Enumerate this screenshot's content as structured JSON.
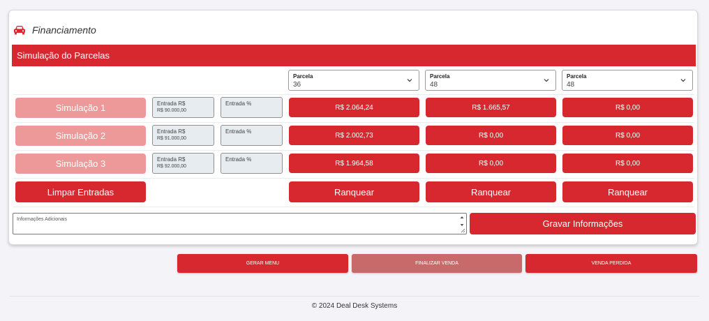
{
  "card": {
    "title": "Financiamento",
    "section_title": "Simulação do Parcelas",
    "selects": [
      {
        "label": "Parcela",
        "value": "36"
      },
      {
        "label": "Parcela",
        "value": "48"
      },
      {
        "label": "Parcela",
        "value": "48"
      }
    ],
    "simulations": [
      {
        "label": "Simulação 1",
        "entry_rs_label": "Entrada R$",
        "entry_rs_value": "R$ 90.000,00",
        "entry_pct_label": "Entrada %",
        "values": [
          "R$ 2.064,24",
          "R$ 1.665,57",
          "R$ 0,00"
        ]
      },
      {
        "label": "Simulação 2",
        "entry_rs_label": "Entrada R$",
        "entry_rs_value": "R$ 91.000,00",
        "entry_pct_label": "Entrada %",
        "values": [
          "R$ 2.002,73",
          "R$ 0,00",
          "R$ 0,00"
        ]
      },
      {
        "label": "Simulação 3",
        "entry_rs_label": "Entrada R$",
        "entry_rs_value": "R$ 92.000,00",
        "entry_pct_label": "Entrada %",
        "values": [
          "R$ 1.964,58",
          "R$ 0,00",
          "R$ 0,00"
        ]
      }
    ],
    "clear_button": "Limpar Entradas",
    "rank_buttons": [
      "Ranquear",
      "Ranquear",
      "Ranquear"
    ],
    "notes_placeholder": "Informações Adicionais",
    "save_button": "Gravar Informações"
  },
  "actions": {
    "generate_menu": "GERAR MENU",
    "finalize_sale": "FINALIZAR VENDA",
    "lost_sale": "VENDA PERDIDA"
  },
  "footer": "© 2024 Deal Desk Systems",
  "colors": {
    "accent": "#d7282f",
    "simulation_button": "#ee9999",
    "disabled_button": "#c96a6a"
  },
  "icons": {
    "header": "car-icon",
    "select": "chevron-down-icon"
  }
}
